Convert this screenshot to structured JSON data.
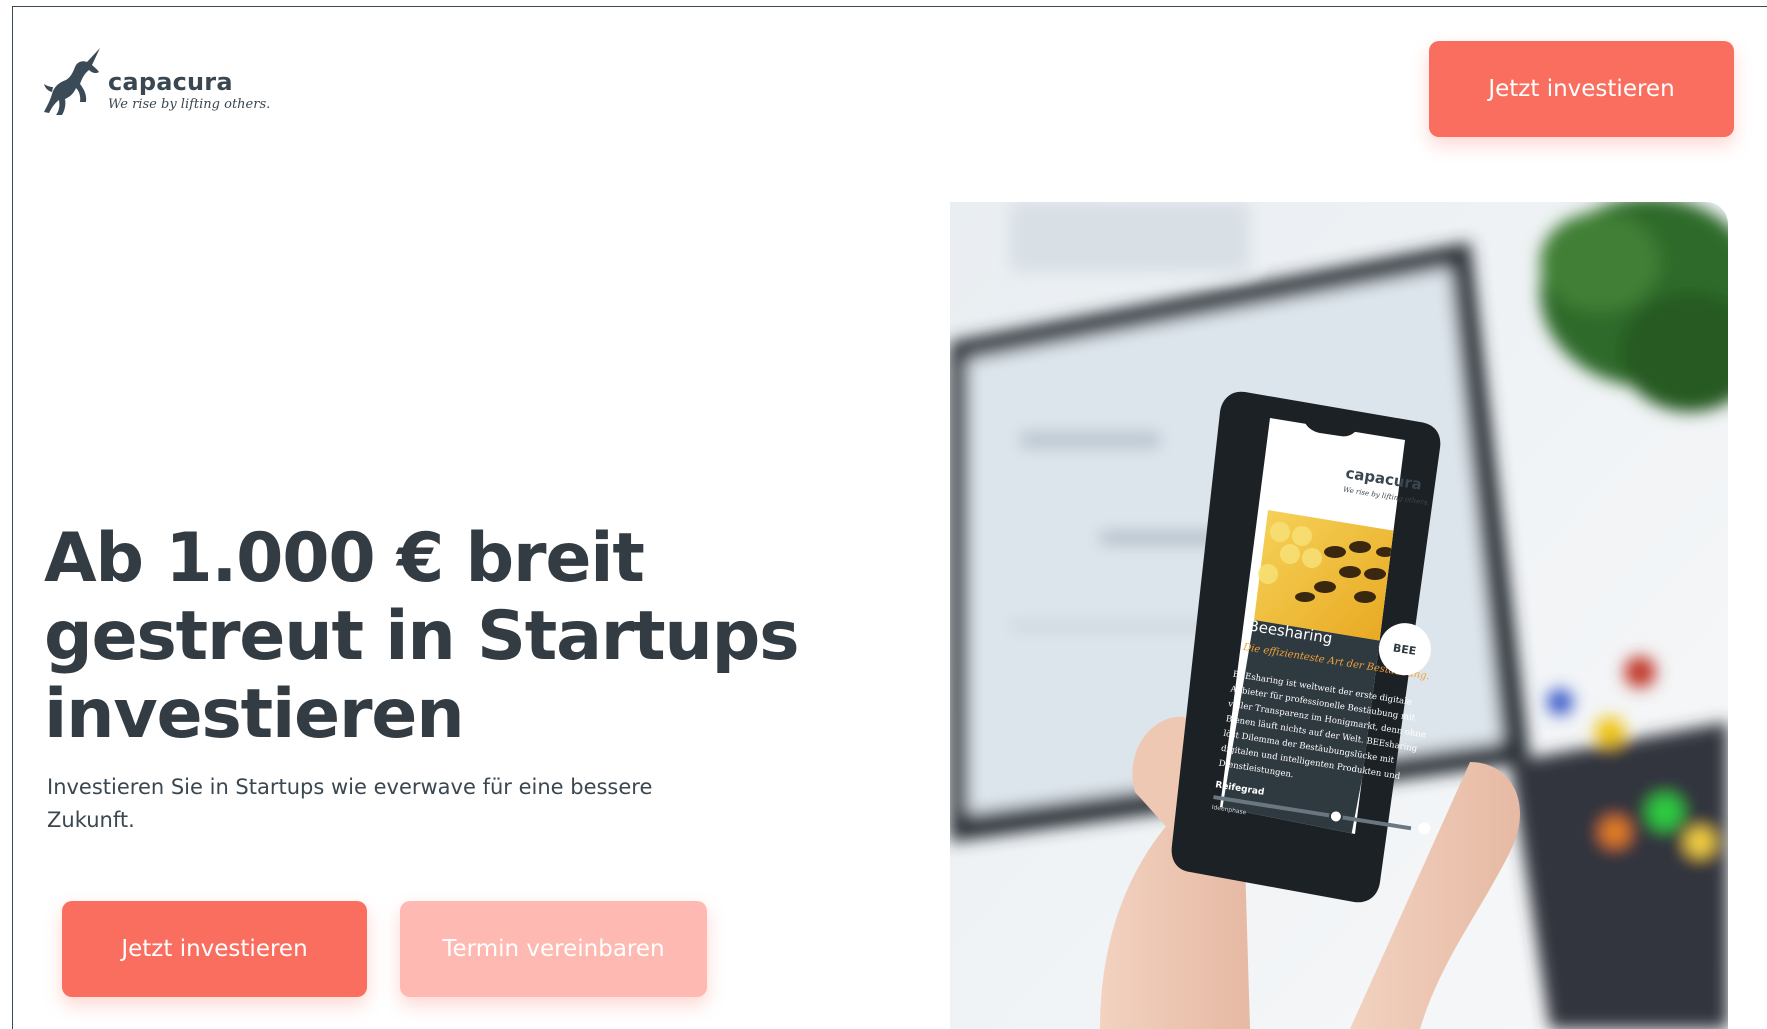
{
  "header": {
    "brand_name": "capacura",
    "tagline": "We rise by lifting others.",
    "cta_label": "Jetzt investieren"
  },
  "hero": {
    "headline": "Ab 1.000 € breit gestreut in Startups investieren",
    "subline": "Investieren Sie in Startups wie everwave für eine bessere Zukunft.",
    "primary_cta": "Jetzt investieren",
    "secondary_cta": "Termin vereinbaren"
  },
  "phone_screen": {
    "brand_name": "capacura",
    "tagline": "We rise by lifting others.",
    "card_title": "Beesharing",
    "card_subtitle": "Die effizienteste Art der Bestäubung.",
    "badge": "BEE",
    "description": "BEEsharing ist weltweit der erste digitale Anbieter für professionelle Bestäubung mit voller Transparenz im Honigmarkt, denn ohne Bienen läuft nichts auf der Welt. BEEsharing löst Dilemma der Bestäubungslücke mit digitalen und intelligenten Produkten und Dienstleistungen.",
    "maturity_label": "Reifegrad",
    "maturity_stage": "Ideenphase",
    "maturity_value": 0.62
  },
  "colors": {
    "accent": "#fa6e60",
    "accent_light": "#fdb9b2",
    "text": "#323c42"
  },
  "icons": {
    "logo": "unicorn-icon",
    "help": "question-icon"
  }
}
